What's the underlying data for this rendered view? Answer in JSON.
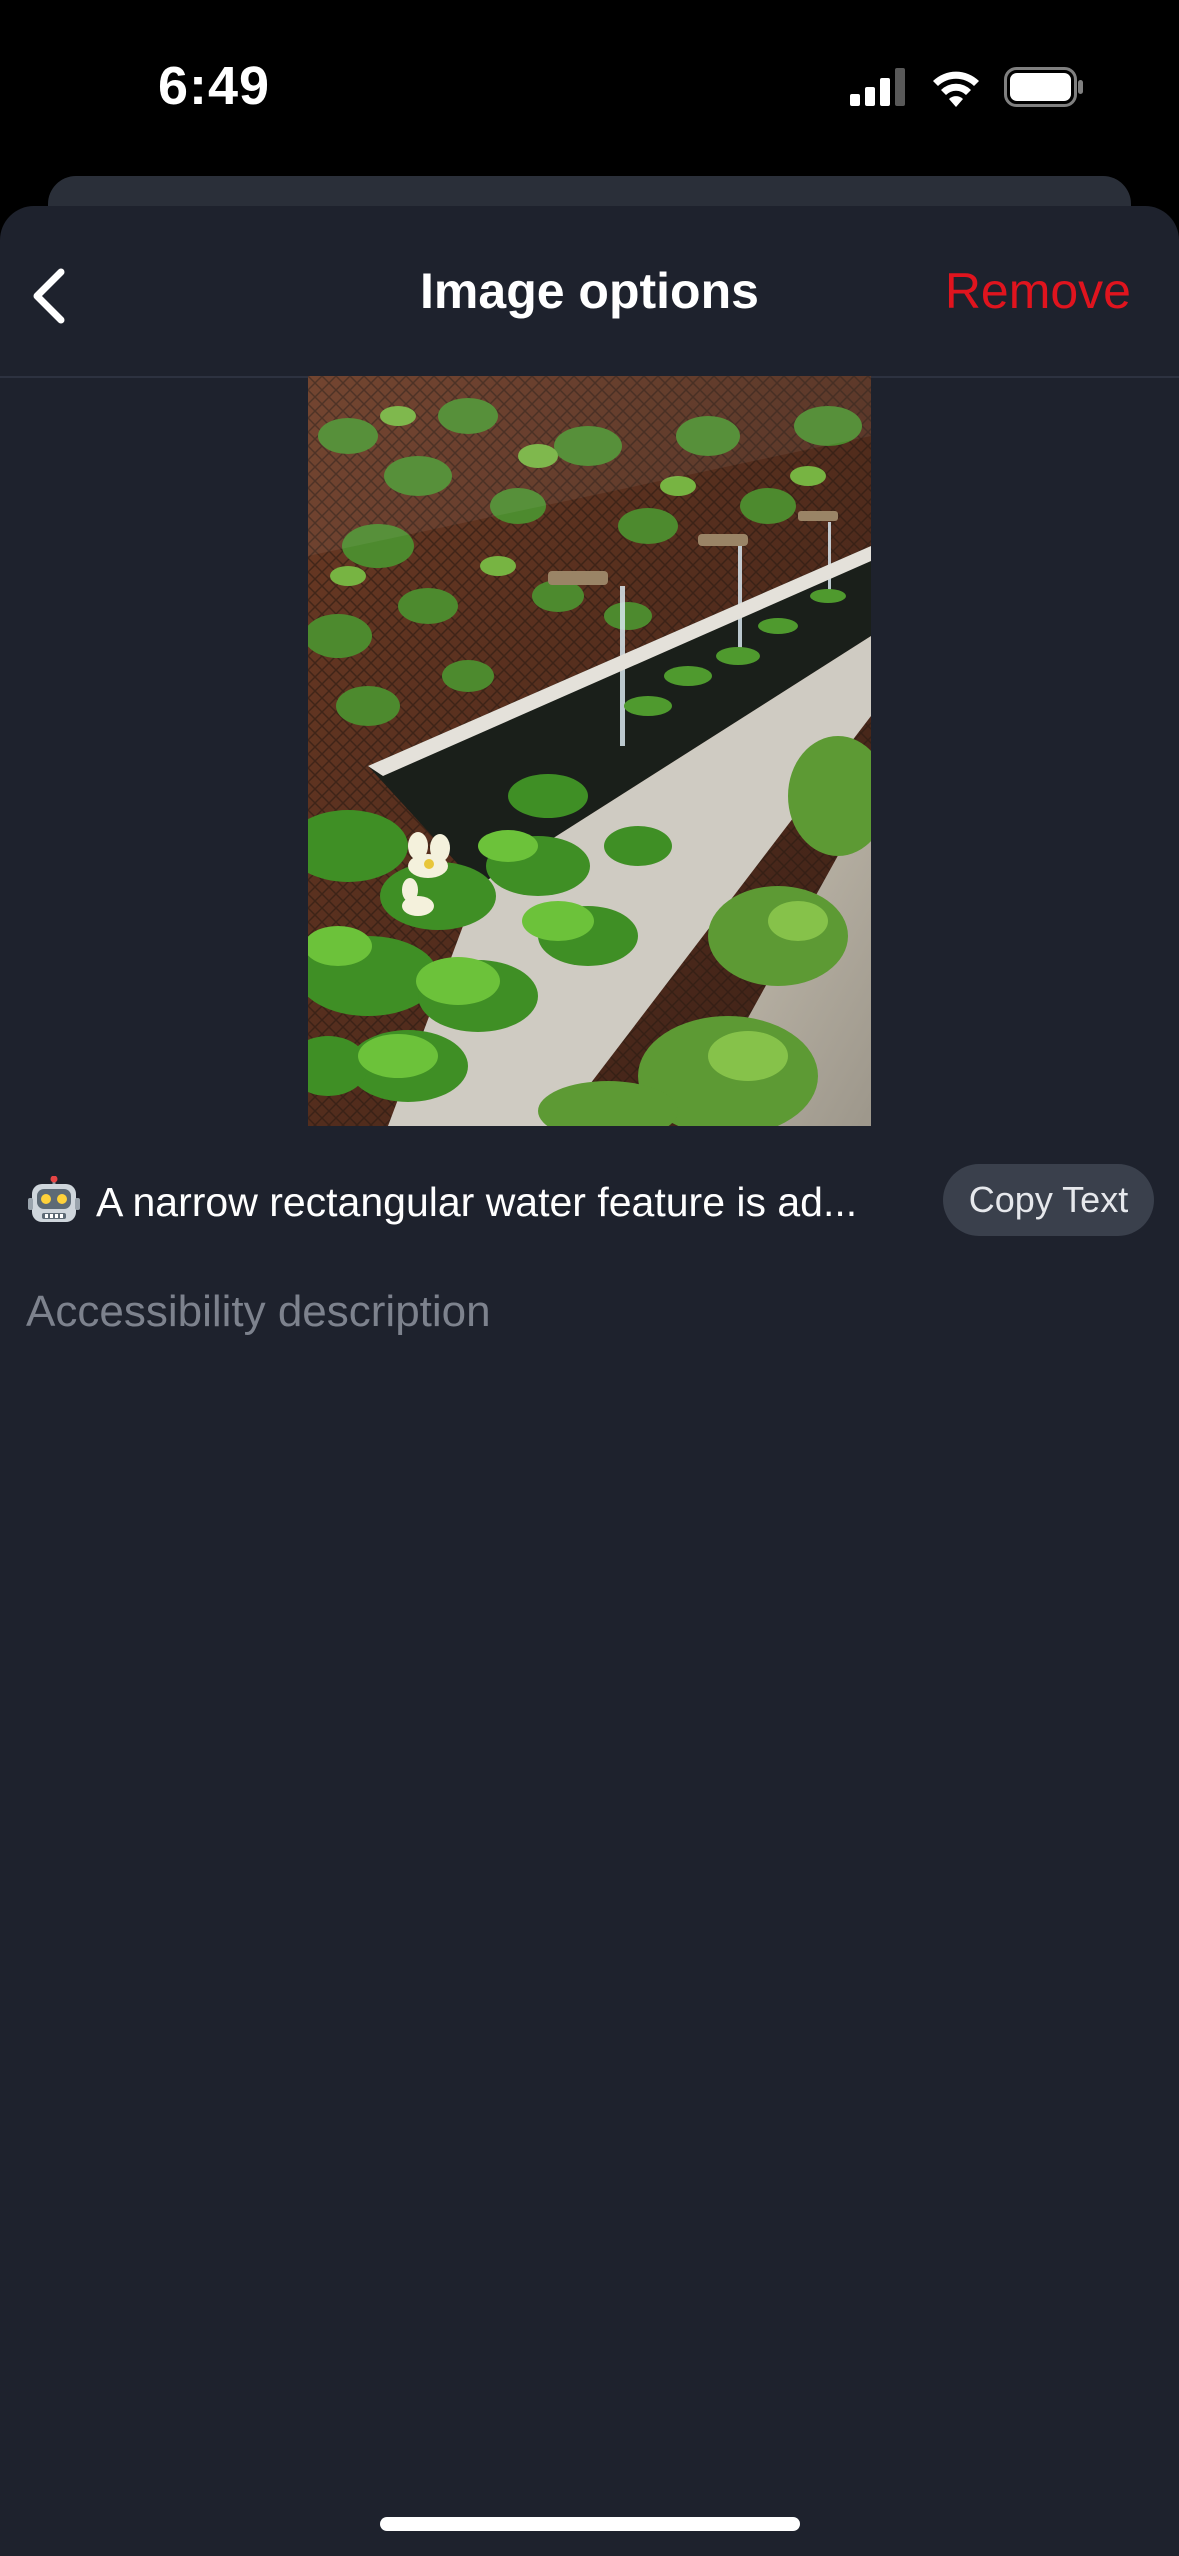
{
  "status_bar": {
    "time": "6:49",
    "icons": [
      "cellular-signal-icon",
      "wifi-icon",
      "battery-icon"
    ]
  },
  "nav": {
    "back_icon": "chevron-left-icon",
    "title": "Image options",
    "remove_label": "Remove"
  },
  "alt_text": {
    "icon": "robot-emoji-icon",
    "text": "A narrow rectangular water feature is ad...",
    "copy_label": "Copy Text"
  },
  "description": {
    "value": "",
    "placeholder": "Accessibility description"
  },
  "colors": {
    "background": "#1e222d",
    "accent_remove": "#e0141e",
    "chip": "#3a404c",
    "placeholder": "#7d828d"
  }
}
